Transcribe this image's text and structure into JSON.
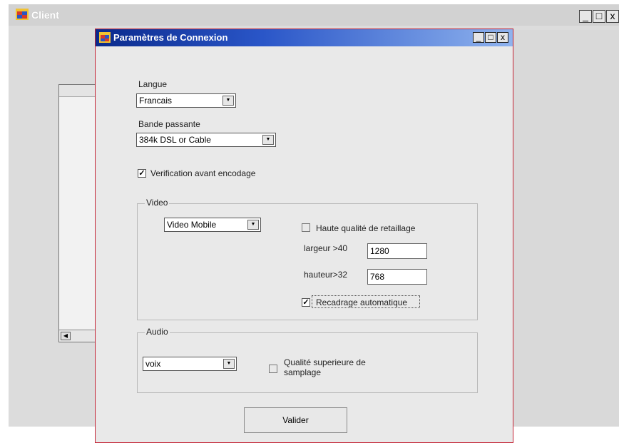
{
  "client_window": {
    "title": "Client",
    "controls": {
      "minimize": "_",
      "maximize": "□",
      "close": "x"
    }
  },
  "dialog": {
    "title": "Paramètres de Connexion",
    "controls": {
      "minimize": "_",
      "maximize": "□",
      "close": "x"
    },
    "language": {
      "label": "Langue",
      "value": "Francais"
    },
    "bandwidth": {
      "label": "Bande passante",
      "value": "384k DSL or Cable"
    },
    "verification": {
      "label": "Verification avant encodage",
      "checked": true
    },
    "video": {
      "legend": "Video",
      "preset": "Video Mobile",
      "high_quality": {
        "label": "Haute qualité de retaillage",
        "checked": false
      },
      "width": {
        "label": "largeur >40",
        "value": "1280"
      },
      "height": {
        "label": "hauteur>32",
        "value": "768"
      },
      "auto_crop": {
        "label": "Recadrage automatique",
        "checked": true
      }
    },
    "audio": {
      "legend": "Audio",
      "preset": "voix",
      "high_quality": {
        "label_line1": "Qualité superieure de",
        "label_line2": "samplage",
        "checked": false
      }
    },
    "validate_button": "Valider"
  },
  "icons": {
    "client_app": "app-window-icon",
    "dialog_app": "app-window-icon",
    "dropdown": "chevron-down-icon",
    "check": "✓",
    "scroll_left": "chevron-left-icon"
  },
  "colors": {
    "dialog_title_gradient_start": "#0a2a8c",
    "dialog_title_gradient_end": "#8fb3ee",
    "dialog_border": "#c42233"
  }
}
